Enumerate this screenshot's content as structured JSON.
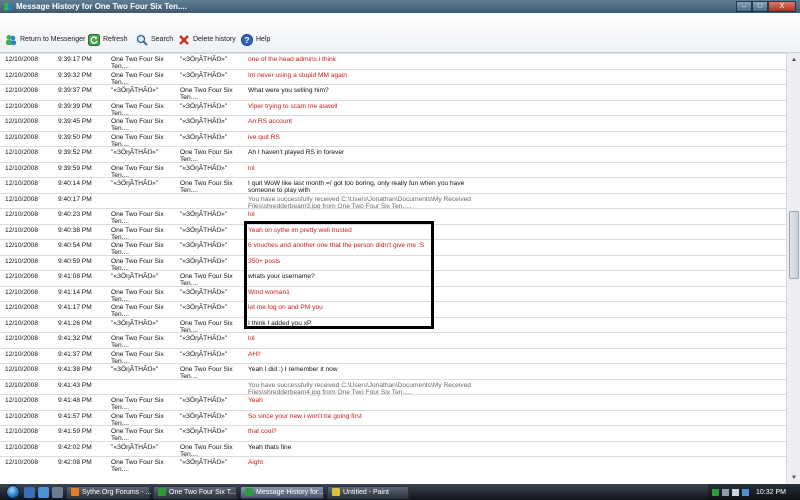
{
  "window": {
    "title": "Message History for One Two Four Six Ten....",
    "minimize": "–",
    "maximize": "□",
    "close": "X"
  },
  "toolbar": {
    "return_label": "Return to Messenger",
    "refresh_label": "Refresh",
    "search_label": "Search",
    "delete_label": "Delete history",
    "help_label": "Help"
  },
  "rows": [
    {
      "date": "12/10/2008",
      "time": "9:39:17 PM",
      "from": "One Two Four Six Ten....",
      "to": "\"«ЗÖŋÃТНÃŊ»\"",
      "msg": "one of the head admins i think",
      "color": "red"
    },
    {
      "date": "12/10/2008",
      "time": "9:39:32 PM",
      "from": "One Two Four Six Ten....",
      "to": "\"«ЗÖŋÃТНÃŊ»\"",
      "msg": "Im never using a stupid MM again",
      "color": "red"
    },
    {
      "date": "12/10/2008",
      "time": "9:39:37 PM",
      "from": "\"«ЗÖŋÃТНÃŊ»\"",
      "to": "One Two Four Six Ten....",
      "msg": "What were you selling him?",
      "color": "black"
    },
    {
      "date": "12/10/2008",
      "time": "9:39:39 PM",
      "from": "One Two Four Six Ten....",
      "to": "\"«ЗÖŋÃТНÃŊ»\"",
      "msg": "Viper trying to scam me aswell",
      "color": "red"
    },
    {
      "date": "12/10/2008",
      "time": "9:39:45 PM",
      "from": "One Two Four Six Ten....",
      "to": "\"«ЗÖŋÃТНÃŊ»\"",
      "msg": "An RS account",
      "color": "red"
    },
    {
      "date": "12/10/2008",
      "time": "9:39:50 PM",
      "from": "One Two Four Six Ten....",
      "to": "\"«ЗÖŋÃТНÃŊ»\"",
      "msg": "ive quit RS",
      "color": "red"
    },
    {
      "date": "12/10/2008",
      "time": "9:39:52 PM",
      "from": "\"«ЗÖŋÃТНÃŊ»\"",
      "to": "One Two Four Six Ten....",
      "msg": "Ah I haven't played RS in forever",
      "color": "black"
    },
    {
      "date": "12/10/2008",
      "time": "9:39:59 PM",
      "from": "One Two Four Six Ten....",
      "to": "\"«ЗÖŋÃТНÃŊ»\"",
      "msg": "lol",
      "color": "red"
    },
    {
      "date": "12/10/2008",
      "time": "9:40:14 PM",
      "from": "\"«ЗÖŋÃТНÃŊ»\"",
      "to": "One Two Four Six Ten....",
      "msg": "I quit WoW like last month =/ got too boring, only really fun when you have someone to play with",
      "color": "black"
    },
    {
      "date": "12/10/2008",
      "time": "9:40:17 PM",
      "from": "",
      "to": "",
      "msg": "You have successfully received C:\\Users\\Jonathan\\Documents\\My Received Files\\shredderbeam3.jpg from One Two Four Six Ten.....",
      "color": "grey"
    },
    {
      "date": "12/10/2008",
      "time": "9:40:23 PM",
      "from": "One Two Four Six Ten....",
      "to": "\"«ЗÖŋÃТНÃŊ»\"",
      "msg": "lol",
      "color": "red"
    },
    {
      "date": "12/10/2008",
      "time": "9:40:38 PM",
      "from": "One Two Four Six Ten....",
      "to": "\"«ЗÖŋÃТНÃŊ»\"",
      "msg": "Yeah  on sythe im pretty well trusted",
      "color": "red"
    },
    {
      "date": "12/10/2008",
      "time": "9:40:54 PM",
      "from": "One Two Four Six Ten....",
      "to": "\"«ЗÖŋÃТНÃŊ»\"",
      "msg": "6 vouches and another one that the person didn't give me :S",
      "color": "red"
    },
    {
      "date": "12/10/2008",
      "time": "9:40:59 PM",
      "from": "One Two Four Six Ten....",
      "to": "\"«ЗÖŋÃТНÃŊ»\"",
      "msg": "350+ posts",
      "color": "red"
    },
    {
      "date": "12/10/2008",
      "time": "9:41:08 PM",
      "from": "\"«ЗÖŋÃТНÃŊ»\"",
      "to": "One Two Four Six Ten....",
      "msg": "whats your username?",
      "color": "black"
    },
    {
      "date": "12/10/2008",
      "time": "9:41:14 PM",
      "from": "One Two Four Six Ten....",
      "to": "\"«ЗÖŋÃТНÃŊ»\"",
      "msg": "Wind woman1",
      "color": "red"
    },
    {
      "date": "12/10/2008",
      "time": "9:41:17 PM",
      "from": "One Two Four Six Ten....",
      "to": "\"«ЗÖŋÃТНÃŊ»\"",
      "msg": "let me log on and PM you",
      "color": "red"
    },
    {
      "date": "12/10/2008",
      "time": "9:41:26 PM",
      "from": "\"«ЗÖŋÃТНÃŊ»\"",
      "to": "One Two Four Six Ten....",
      "msg": "I think I added you xP",
      "color": "black"
    },
    {
      "date": "12/10/2008",
      "time": "9:41:32 PM",
      "from": "One Two Four Six Ten....",
      "to": "\"«ЗÖŋÃТНÃŊ»\"",
      "msg": "lol",
      "color": "red"
    },
    {
      "date": "12/10/2008",
      "time": "9:41:37 PM",
      "from": "One Two Four Six Ten....",
      "to": "\"«ЗÖŋÃТНÃŊ»\"",
      "msg": "AH!!",
      "color": "red"
    },
    {
      "date": "12/10/2008",
      "time": "9:41:38 PM",
      "from": "\"«ЗÖŋÃТНÃŊ»\"",
      "to": "One Two Four Six Ten....",
      "msg": "Yeah I did :) I remember it now",
      "color": "black"
    },
    {
      "date": "12/10/2008",
      "time": "9:41:43 PM",
      "from": "",
      "to": "",
      "msg": "You have successfully received C:\\Users\\Jonathan\\Documents\\My Received Files\\shredderbeam4.jpg from One Two Four Six Ten.....",
      "color": "grey"
    },
    {
      "date": "12/10/2008",
      "time": "9:41:48 PM",
      "from": "One Two Four Six Ten....",
      "to": "\"«ЗÖŋÃТНÃŊ»\"",
      "msg": "Yeah",
      "color": "red"
    },
    {
      "date": "12/10/2008",
      "time": "9:41:57 PM",
      "from": "One Two Four Six Ten....",
      "to": "\"«ЗÖŋÃТНÃŊ»\"",
      "msg": "So since your new i won't be going first",
      "color": "red"
    },
    {
      "date": "12/10/2008",
      "time": "9:41:59 PM",
      "from": "One Two Four Six Ten....",
      "to": "\"«ЗÖŋÃТНÃŊ»\"",
      "msg": "that cool?",
      "color": "red"
    },
    {
      "date": "12/10/2008",
      "time": "9:42:02 PM",
      "from": "\"«ЗÖŋÃТНÃŊ»\"",
      "to": "One Two Four Six Ten....",
      "msg": "Yeah thats fine",
      "color": "black"
    },
    {
      "date": "12/10/2008",
      "time": "9:42:08 PM",
      "from": "One Two Four Six Ten....",
      "to": "\"«ЗÖŋÃТНÃŊ»\"",
      "msg": "Aight",
      "color": "red"
    }
  ],
  "taskbar": {
    "tasks": [
      {
        "label": "Sythe.Org Forums - ...",
        "color": "#e8801f",
        "active": false
      },
      {
        "label": "One Two Four Six T...",
        "color": "#2f9a3c",
        "active": false
      },
      {
        "label": "Message History for...",
        "color": "#2f9a3c",
        "active": true
      },
      {
        "label": "Untitled - Paint",
        "color": "#d8c23a",
        "active": false
      }
    ],
    "clock": "10:32 PM"
  }
}
